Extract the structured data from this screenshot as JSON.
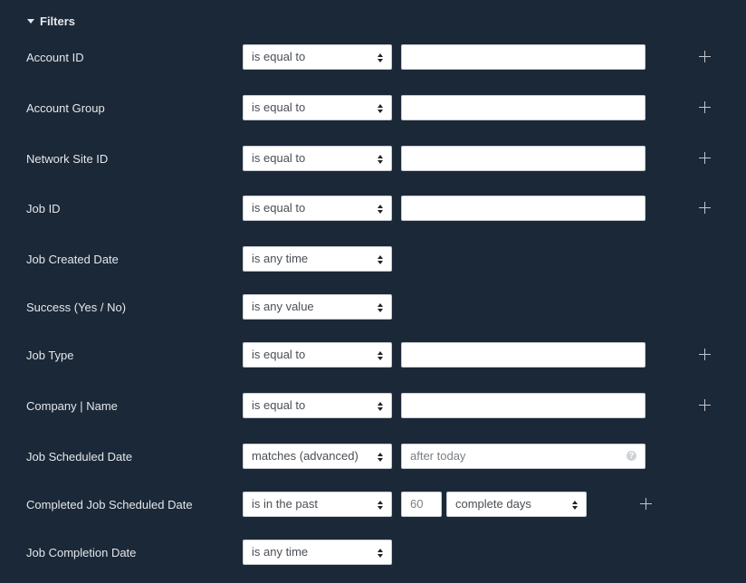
{
  "section": {
    "title": "Filters"
  },
  "filters": [
    {
      "label": "Account ID",
      "operator": "is equal to",
      "value": ""
    },
    {
      "label": "Account Group",
      "operator": "is equal to",
      "value": ""
    },
    {
      "label": "Network Site ID",
      "operator": "is equal to",
      "value": ""
    },
    {
      "label": "Job ID",
      "operator": "is equal to",
      "value": ""
    },
    {
      "label": "Job Created Date",
      "operator": "is any time"
    },
    {
      "label": "Success (Yes / No)",
      "operator": "is any value"
    },
    {
      "label": "Job Type",
      "operator": "is equal to",
      "value": ""
    },
    {
      "label": "Company | Name",
      "operator": "is equal to",
      "value": ""
    },
    {
      "label": "Job Scheduled Date",
      "operator": "matches (advanced)",
      "placeholder": "after today",
      "help_icon": "?"
    },
    {
      "label": "Completed Job Scheduled Date",
      "operator": "is in the past",
      "number": "60",
      "unit": "complete days"
    },
    {
      "label": "Job Completion Date",
      "operator": "is any time"
    }
  ],
  "icons": {
    "section_toggle": "caret-down-icon",
    "add": "plus-icon",
    "help": "question-circle-icon",
    "select": "sort-arrows-icon"
  }
}
